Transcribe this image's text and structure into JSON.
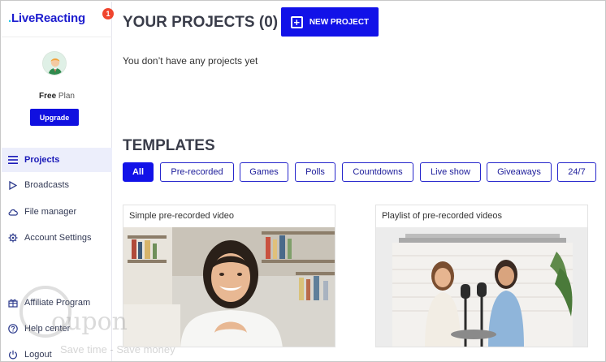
{
  "app": {
    "logo_dot": ".",
    "logo_text": "LiveReacting",
    "notification_count": "1"
  },
  "profile": {
    "plan_bold": "Free",
    "plan_rest": " Plan",
    "upgrade_label": "Upgrade"
  },
  "sidebar": {
    "items": [
      {
        "label": "Projects",
        "icon": "menu-icon",
        "active": true
      },
      {
        "label": "Broadcasts",
        "icon": "play-icon",
        "active": false
      },
      {
        "label": "File manager",
        "icon": "cloud-icon",
        "active": false
      },
      {
        "label": "Account Settings",
        "icon": "gear-icon",
        "active": false
      }
    ],
    "bottom_items": [
      {
        "label": "Affiliate Program",
        "icon": "gift-icon"
      },
      {
        "label": "Help center",
        "icon": "help-icon"
      },
      {
        "label": "Logout",
        "icon": "power-icon"
      }
    ]
  },
  "projects": {
    "title": "YOUR PROJECTS (0)",
    "new_project_label": "NEW PROJECT",
    "empty_message": "You don’t have any projects yet"
  },
  "templates": {
    "title": "TEMPLATES",
    "filters": [
      "All",
      "Pre-recorded",
      "Games",
      "Polls",
      "Countdowns",
      "Live show",
      "Giveaways",
      "24/7"
    ],
    "active_filter": "All",
    "cards": [
      {
        "title": "Simple pre-recorded video"
      },
      {
        "title": "Playlist of pre-recorded videos"
      }
    ]
  },
  "watermark": {
    "word": "oupon",
    "tagline": "Save time - Save money"
  },
  "colors": {
    "accent": "#1212e8",
    "brand": "#1d1dcf",
    "badge": "#f0452e"
  }
}
